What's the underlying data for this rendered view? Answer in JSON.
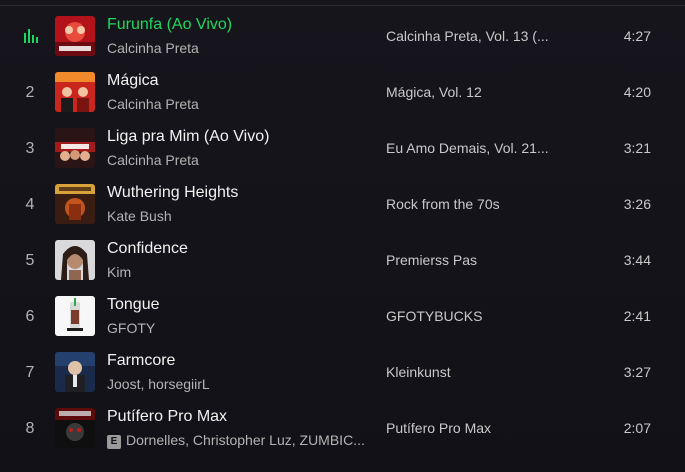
{
  "tracks": [
    {
      "index": "1",
      "title": "Furunfa (Ao Vivo)",
      "artist": "Calcinha Preta",
      "album": "Calcinha Preta, Vol. 13 (...",
      "duration": "4:27",
      "playing": true,
      "explicit": false,
      "cover_icon": "calcinha-preta-vol13-cover"
    },
    {
      "index": "2",
      "title": "Mágica",
      "artist": "Calcinha Preta",
      "album": "Mágica, Vol. 12",
      "duration": "4:20",
      "playing": false,
      "explicit": false,
      "cover_icon": "calcinha-preta-magica-cover"
    },
    {
      "index": "3",
      "title": "Liga pra Mim (Ao Vivo)",
      "artist": "Calcinha Preta",
      "album": "Eu Amo Demais, Vol. 21...",
      "duration": "3:21",
      "playing": false,
      "explicit": false,
      "cover_icon": "eu-amo-demais-cover"
    },
    {
      "index": "4",
      "title": "Wuthering Heights",
      "artist": "Kate Bush",
      "album": "Rock from the 70s",
      "duration": "3:26",
      "playing": false,
      "explicit": false,
      "cover_icon": "rock-70s-cover"
    },
    {
      "index": "5",
      "title": "Confidence",
      "artist": "Kim",
      "album": "Premierss Pas",
      "duration": "3:44",
      "playing": false,
      "explicit": false,
      "cover_icon": "premierss-pas-cover"
    },
    {
      "index": "6",
      "title": "Tongue",
      "artist": "GFOTY",
      "album": "GFOTYBUCKS",
      "duration": "2:41",
      "playing": false,
      "explicit": false,
      "cover_icon": "gfotybucks-cover"
    },
    {
      "index": "7",
      "title": "Farmcore",
      "artist": "Joost, horsegiirL",
      "album": "Kleinkunst",
      "duration": "3:27",
      "playing": false,
      "explicit": false,
      "cover_icon": "kleinkunst-cover"
    },
    {
      "index": "8",
      "title": "Putífero Pro Max",
      "artist": "Dornelles, Christopher Luz, ZUMBIC...",
      "album": "Putífero Pro Max",
      "duration": "2:07",
      "playing": false,
      "explicit": true,
      "explicit_label": "E",
      "cover_icon": "putifero-cover"
    }
  ],
  "colors": {
    "background": "#121117",
    "playing_accent": "#1ed760",
    "title_text": "#f2f2f2",
    "secondary_text": "#b3b3b3"
  }
}
